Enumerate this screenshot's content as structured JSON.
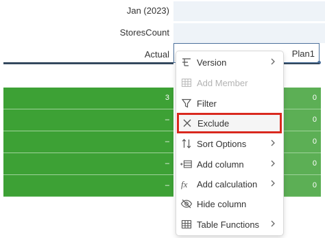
{
  "header": {
    "date_label": "Jan (2023)",
    "measure_label": "StoresCount",
    "category_label": "Actual",
    "version_value": "Plan1"
  },
  "grid": {
    "left_values": [
      "3",
      "–",
      "–",
      "–",
      "–"
    ],
    "right_values": [
      "0",
      "0",
      "0",
      "0",
      "0"
    ]
  },
  "colors": {
    "grid_green": "#3da135",
    "highlight_red": "#d9281e",
    "header_fill": "#eef3f8"
  },
  "menu": {
    "items": [
      {
        "label": "Version",
        "icon": "version-icon",
        "submenu": true,
        "enabled": true
      },
      {
        "label": "Add Member",
        "icon": "add-member-icon",
        "submenu": false,
        "enabled": false
      },
      {
        "label": "Filter",
        "icon": "filter-icon",
        "submenu": false,
        "enabled": true
      },
      {
        "label": "Exclude",
        "icon": "close-icon",
        "submenu": false,
        "enabled": true,
        "highlighted": true
      },
      {
        "label": "Sort Options",
        "icon": "sort-icon",
        "submenu": true,
        "enabled": true
      },
      {
        "label": "Add column",
        "icon": "add-column-icon",
        "submenu": true,
        "enabled": true
      },
      {
        "label": "Add calculation",
        "icon": "function-icon",
        "submenu": true,
        "enabled": true
      },
      {
        "label": "Hide column",
        "icon": "hide-icon",
        "submenu": false,
        "enabled": true
      },
      {
        "label": "Table Functions",
        "icon": "table-icon",
        "submenu": true,
        "enabled": true
      }
    ]
  }
}
